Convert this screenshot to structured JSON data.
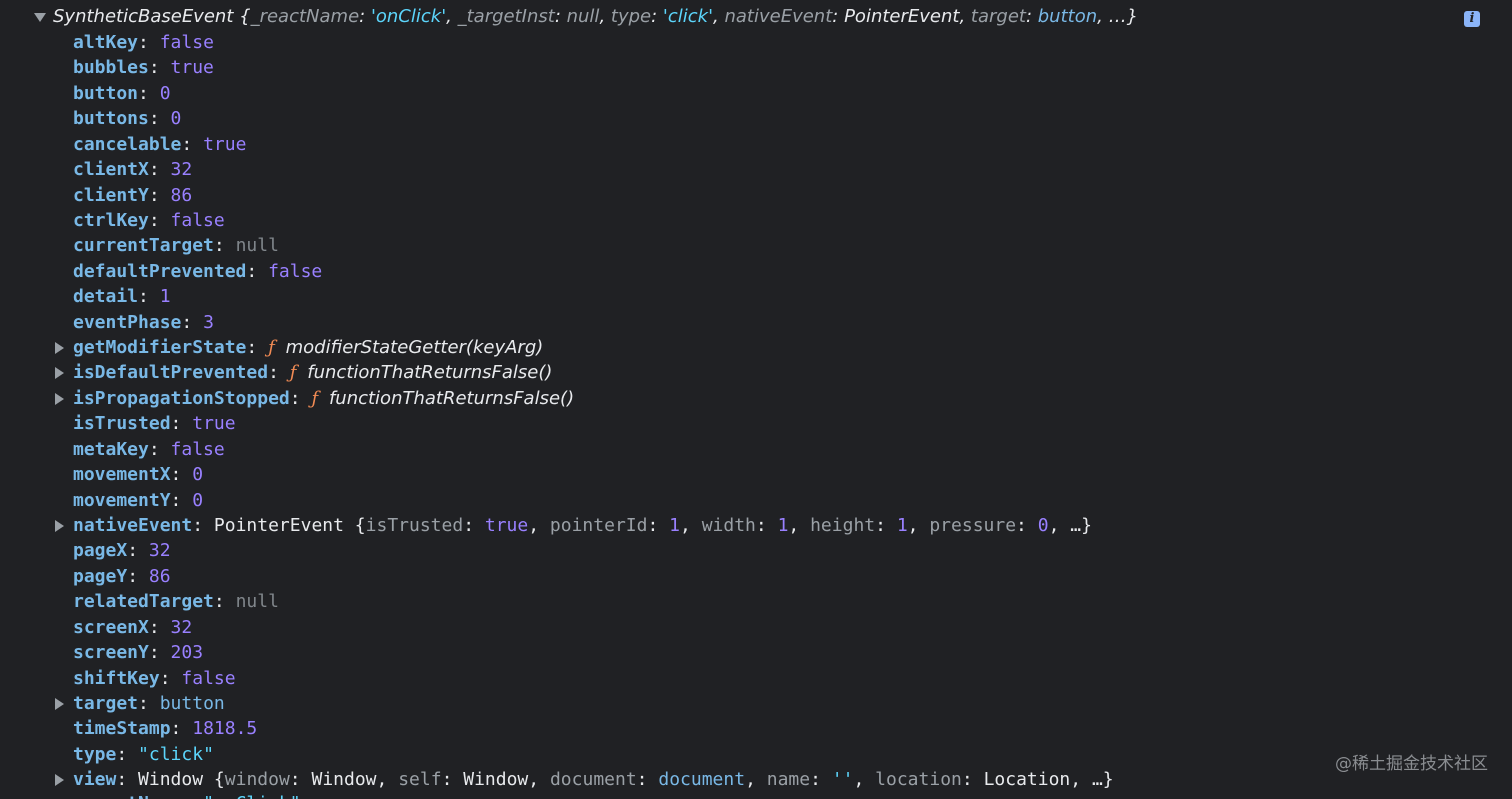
{
  "header": {
    "class_name": "SyntheticBaseEvent",
    "open_brace": " {",
    "items": [
      {
        "key": "_reactName",
        "sep": ": ",
        "value": "'onClick'",
        "kind": "str",
        "after": ", "
      },
      {
        "key": "_targetInst",
        "sep": ": ",
        "value": "null",
        "kind": "null",
        "after": ", "
      },
      {
        "key": "type",
        "sep": ": ",
        "value": "'click'",
        "kind": "str",
        "after": ", "
      },
      {
        "key": "nativeEvent",
        "sep": ": ",
        "value": "PointerEvent",
        "kind": "ctor",
        "after": ", "
      },
      {
        "key": "target",
        "sep": ": ",
        "value": "button",
        "kind": "node",
        "after": ", "
      }
    ],
    "ellipsis": "…}",
    "info_icon": "info-icon",
    "info_glyph": "i"
  },
  "properties": [
    {
      "key": "altKey",
      "value": "false",
      "kind": "bool",
      "expandable": false
    },
    {
      "key": "bubbles",
      "value": "true",
      "kind": "bool",
      "expandable": false
    },
    {
      "key": "button",
      "value": "0",
      "kind": "num",
      "expandable": false
    },
    {
      "key": "buttons",
      "value": "0",
      "kind": "num",
      "expandable": false
    },
    {
      "key": "cancelable",
      "value": "true",
      "kind": "bool",
      "expandable": false
    },
    {
      "key": "clientX",
      "value": "32",
      "kind": "num",
      "expandable": false
    },
    {
      "key": "clientY",
      "value": "86",
      "kind": "num",
      "expandable": false
    },
    {
      "key": "ctrlKey",
      "value": "false",
      "kind": "bool",
      "expandable": false
    },
    {
      "key": "currentTarget",
      "value": "null",
      "kind": "null",
      "expandable": false
    },
    {
      "key": "defaultPrevented",
      "value": "false",
      "kind": "bool",
      "expandable": false
    },
    {
      "key": "detail",
      "value": "1",
      "kind": "num",
      "expandable": false
    },
    {
      "key": "eventPhase",
      "value": "3",
      "kind": "num",
      "expandable": false
    },
    {
      "key": "getModifierState",
      "value": "modifierStateGetter(keyArg)",
      "kind": "fn",
      "expandable": true
    },
    {
      "key": "isDefaultPrevented",
      "value": "functionThatReturnsFalse()",
      "kind": "fn",
      "expandable": true
    },
    {
      "key": "isPropagationStopped",
      "value": "functionThatReturnsFalse()",
      "kind": "fn",
      "expandable": true
    },
    {
      "key": "isTrusted",
      "value": "true",
      "kind": "bool",
      "expandable": false
    },
    {
      "key": "metaKey",
      "value": "false",
      "kind": "bool",
      "expandable": false
    },
    {
      "key": "movementX",
      "value": "0",
      "kind": "num",
      "expandable": false
    },
    {
      "key": "movementY",
      "value": "0",
      "kind": "num",
      "expandable": false
    },
    {
      "key": "nativeEvent",
      "kind": "obj",
      "expandable": true,
      "ctor": "PointerEvent",
      "entries": [
        {
          "k": "isTrusted",
          "v": "true",
          "kind": "bool"
        },
        {
          "k": "pointerId",
          "v": "1",
          "kind": "num"
        },
        {
          "k": "width",
          "v": "1",
          "kind": "num"
        },
        {
          "k": "height",
          "v": "1",
          "kind": "num"
        },
        {
          "k": "pressure",
          "v": "0",
          "kind": "num"
        }
      ]
    },
    {
      "key": "pageX",
      "value": "32",
      "kind": "num",
      "expandable": false
    },
    {
      "key": "pageY",
      "value": "86",
      "kind": "num",
      "expandable": false
    },
    {
      "key": "relatedTarget",
      "value": "null",
      "kind": "null",
      "expandable": false
    },
    {
      "key": "screenX",
      "value": "32",
      "kind": "num",
      "expandable": false
    },
    {
      "key": "screenY",
      "value": "203",
      "kind": "num",
      "expandable": false
    },
    {
      "key": "shiftKey",
      "value": "false",
      "kind": "bool",
      "expandable": false
    },
    {
      "key": "target",
      "value": "button",
      "kind": "node",
      "expandable": true
    },
    {
      "key": "timeStamp",
      "value": "1818.5",
      "kind": "num",
      "expandable": false
    },
    {
      "key": "type",
      "value": "\"click\"",
      "kind": "str",
      "expandable": false
    },
    {
      "key": "view",
      "kind": "obj",
      "expandable": true,
      "ctor": "Window",
      "entries": [
        {
          "k": "window",
          "v": "Window",
          "kind": "ctor"
        },
        {
          "k": "self",
          "v": "Window",
          "kind": "ctor"
        },
        {
          "k": "document",
          "v": "document",
          "kind": "node"
        },
        {
          "k": "name",
          "v": "''",
          "kind": "str"
        },
        {
          "k": "location",
          "v": "Location",
          "kind": "ctor"
        }
      ]
    }
  ],
  "cut_row": {
    "key": "_reactName",
    "value": "\"onClick\""
  },
  "fn_glyph": "ƒ",
  "watermark": "@稀土掘金技术社区",
  "colors": {
    "background": "#202124",
    "key": "#79b8e6",
    "bool_num": "#9980ff",
    "string": "#5cd5fb",
    "null": "#80868b",
    "function_f": "#f28b54"
  }
}
